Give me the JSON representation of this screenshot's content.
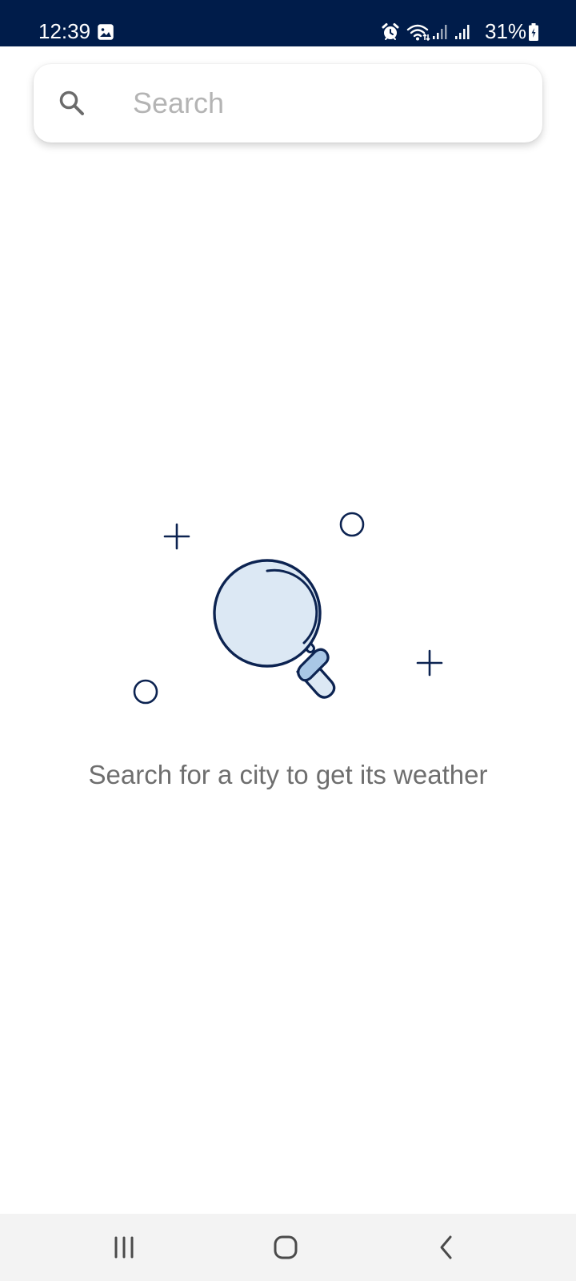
{
  "status_bar": {
    "time": "12:39",
    "battery": "31%",
    "icons": [
      "gallery-notification-icon",
      "alarm-icon",
      "wifi-icon",
      "signal-icon",
      "signal-icon",
      "battery-charging-icon"
    ],
    "background": "#001c4a"
  },
  "search": {
    "placeholder": "Search",
    "value": "",
    "icon": "search-icon"
  },
  "empty_state": {
    "message": "Search for a city to get its weather",
    "illustration": "magnifying-glass-icon",
    "accent": "#0c2351",
    "fill": "#dce8f4",
    "handle_fill": "#a9c7e6"
  },
  "nav_bar": {
    "buttons": [
      "recent-apps-icon",
      "home-icon",
      "back-icon"
    ]
  }
}
